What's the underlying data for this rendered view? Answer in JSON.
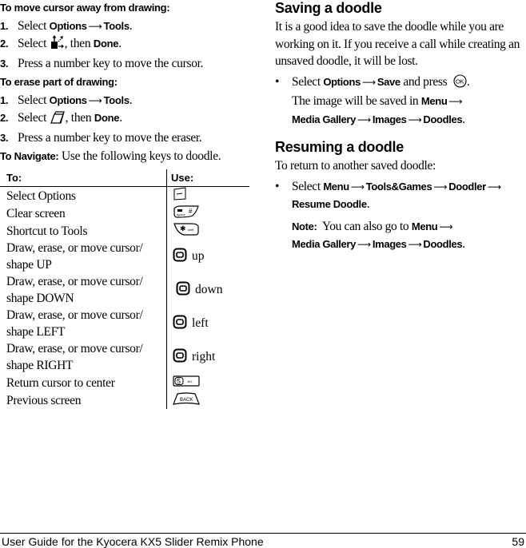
{
  "left": {
    "move_cursor": {
      "heading": "To move cursor away from drawing:",
      "steps": [
        {
          "num": "1.",
          "pre": "Select ",
          "b1": "Options",
          "arrow": "⟶",
          "b2": "Tools",
          "post": "."
        },
        {
          "num": "2.",
          "pre": "Select ",
          "icon": "move-cursor-tool-icon",
          "mid": ", then ",
          "b1": "Done",
          "post": "."
        },
        {
          "num": "3.",
          "text": "Press a number key to move the cursor."
        }
      ]
    },
    "erase": {
      "heading": "To erase part of drawing:",
      "steps": [
        {
          "num": "1.",
          "pre": "Select ",
          "b1": "Options",
          "arrow": "⟶",
          "b2": "Tools",
          "post": "."
        },
        {
          "num": "2.",
          "pre": "Select ",
          "icon": "eraser-tool-icon",
          "mid": ", then ",
          "b1": "Done",
          "post": "."
        },
        {
          "num": "3.",
          "text": "Press a number key to move the eraser."
        }
      ]
    },
    "navigate": {
      "label": "To Navigate:",
      "text": " Use the following keys to doodle."
    },
    "table": {
      "col_to": "To:",
      "col_use": "Use:",
      "rows": [
        {
          "to": [
            "Select Options"
          ],
          "key": "left-softkey-icon",
          "label": ""
        },
        {
          "to": [
            "Clear screen"
          ],
          "key": "pound-key-icon",
          "label": ""
        },
        {
          "to": [
            "Shortcut to Tools"
          ],
          "key": "star-shift-key-icon",
          "label": ""
        },
        {
          "to": [
            "Draw, erase, or move cursor/",
            "shape UP"
          ],
          "key": "nav-key-icon",
          "label": "up"
        },
        {
          "to": [
            "Draw, erase, or move cursor/",
            "shape DOWN"
          ],
          "key": "nav-key-icon",
          "label": "down"
        },
        {
          "to": [
            "Draw, erase, or move cursor/",
            "shape LEFT"
          ],
          "key": "nav-key-icon",
          "label": "left"
        },
        {
          "to": [
            "Draw, erase, or move cursor/",
            "shape RIGHT"
          ],
          "key": "nav-key-icon",
          "label": "right"
        },
        {
          "to": [
            "Return cursor to center"
          ],
          "key": "five-jkl-key-icon",
          "label": ""
        },
        {
          "to": [
            "Previous screen"
          ],
          "key": "back-key-icon",
          "label": ""
        }
      ],
      "key_texts": {
        "five": "5",
        "jkl": "JKL",
        "back": "BACK",
        "shift": "shift",
        "space": "space"
      }
    }
  },
  "right": {
    "saving": {
      "heading": "Saving a doodle",
      "para": "It is a good idea to save the doodle while you are working on it. If you receive a call while creating an unsaved doodle, it will be lost.",
      "bullet": {
        "dot": "•",
        "pre": "Select ",
        "b1": "Options",
        "b2": "Save",
        "mid": " and press ",
        "ok_label": "OK",
        "line2_pre": "The image will be saved in ",
        "b3": "Menu",
        "b4": "Media Gallery",
        "b5": "Images",
        "b6": "Doodles"
      }
    },
    "resuming": {
      "heading": "Resuming a doodle",
      "para": "To return to another saved doodle:",
      "bullet": {
        "dot": "•",
        "pre": "Select ",
        "b1": "Menu",
        "b2": "Tools&Games",
        "b3": "Doodler",
        "b4": "Resume Doodle"
      },
      "note": {
        "label": "Note:",
        "text": "  You can also go to ",
        "b1": "Menu",
        "b2": "Media Gallery",
        "b3": "Images",
        "b4": "Doodles"
      }
    },
    "arrow": "⟶"
  },
  "footer": {
    "title": "User Guide for the Kyocera KX5 Slider Remix Phone",
    "page": "59"
  }
}
